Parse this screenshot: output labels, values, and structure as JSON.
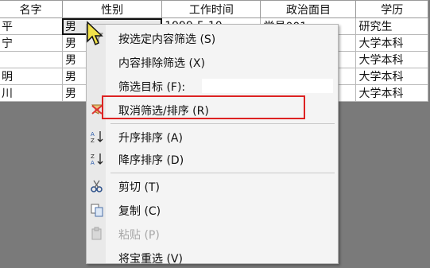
{
  "columns": [
    "名字",
    "性别",
    "工作时间",
    "政治面目",
    "学历"
  ],
  "rows": [
    [
      "平",
      "男",
      "1999-5-10",
      "党员001",
      "研究生"
    ],
    [
      "宁",
      "男",
      "",
      "",
      "大学本科"
    ],
    [
      "",
      "男",
      "",
      "",
      "大学本科"
    ],
    [
      "明",
      "男",
      "",
      "",
      "大学本科"
    ],
    [
      "川",
      "男",
      "",
      "",
      "大学本科"
    ]
  ],
  "menu": {
    "filter_by_selection": "按选定内容筛选 (S)",
    "filter_excluding_selection": "内容排除筛选 (X)",
    "filter_for_label": "筛选目标 (F):",
    "filter_for_value": "",
    "remove_filter_sort": "取消筛选/排序 (R)",
    "sort_ascending": "升序排序 (A)",
    "sort_descending": "降序排序 (D)",
    "cut": "剪切 (T)",
    "copy": "复制 (C)",
    "paste": "粘贴 (P)",
    "insert_object": "将宝重选 (V)"
  },
  "colors": {
    "highlight": "#dd2222",
    "menu_bg": "#f4f4f4"
  }
}
